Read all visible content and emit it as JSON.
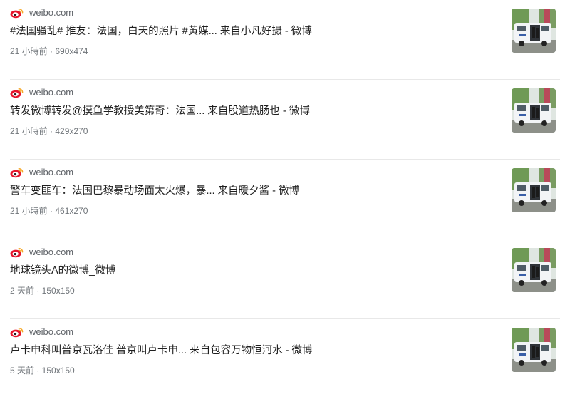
{
  "results": [
    {
      "site": "weibo.com",
      "title": "#法国骚乱# 推友：法国，白天的照片 #黄媒... 来自小凡好摄 - 微博",
      "meta": "21 小時前 · 690x474",
      "logo_icon": "weibo-logo-icon",
      "thumbnail": "police-van-photo"
    },
    {
      "site": "weibo.com",
      "title": "转发微博转发@摸鱼学教授美第奇：法国... 来自股道热肠也 - 微博",
      "meta": "21 小時前 · 429x270",
      "logo_icon": "weibo-logo-icon",
      "thumbnail": "police-van-photo"
    },
    {
      "site": "weibo.com",
      "title": "警车变匪车：法国巴黎暴动场面太火爆，暴... 来自暖夕酱 - 微博",
      "meta": "21 小時前 · 461x270",
      "logo_icon": "weibo-logo-icon",
      "thumbnail": "police-van-photo"
    },
    {
      "site": "weibo.com",
      "title": "地球镜头A的微博_微博",
      "meta": "2 天前 · 150x150",
      "logo_icon": "weibo-logo-icon",
      "thumbnail": "police-van-photo"
    },
    {
      "site": "weibo.com",
      "title": "卢卡申科叫普京瓦洛佳 普京叫卢卡申... 来自包容万物恒河水 - 微博",
      "meta": "5 天前 · 150x150",
      "logo_icon": "weibo-logo-icon",
      "thumbnail": "police-van-photo"
    }
  ],
  "colors": {
    "weibo_red": "#e6162d",
    "weibo_eye": "#f5a623",
    "van_white": "#f2f4f6",
    "foliage": "#5d8a4a"
  }
}
